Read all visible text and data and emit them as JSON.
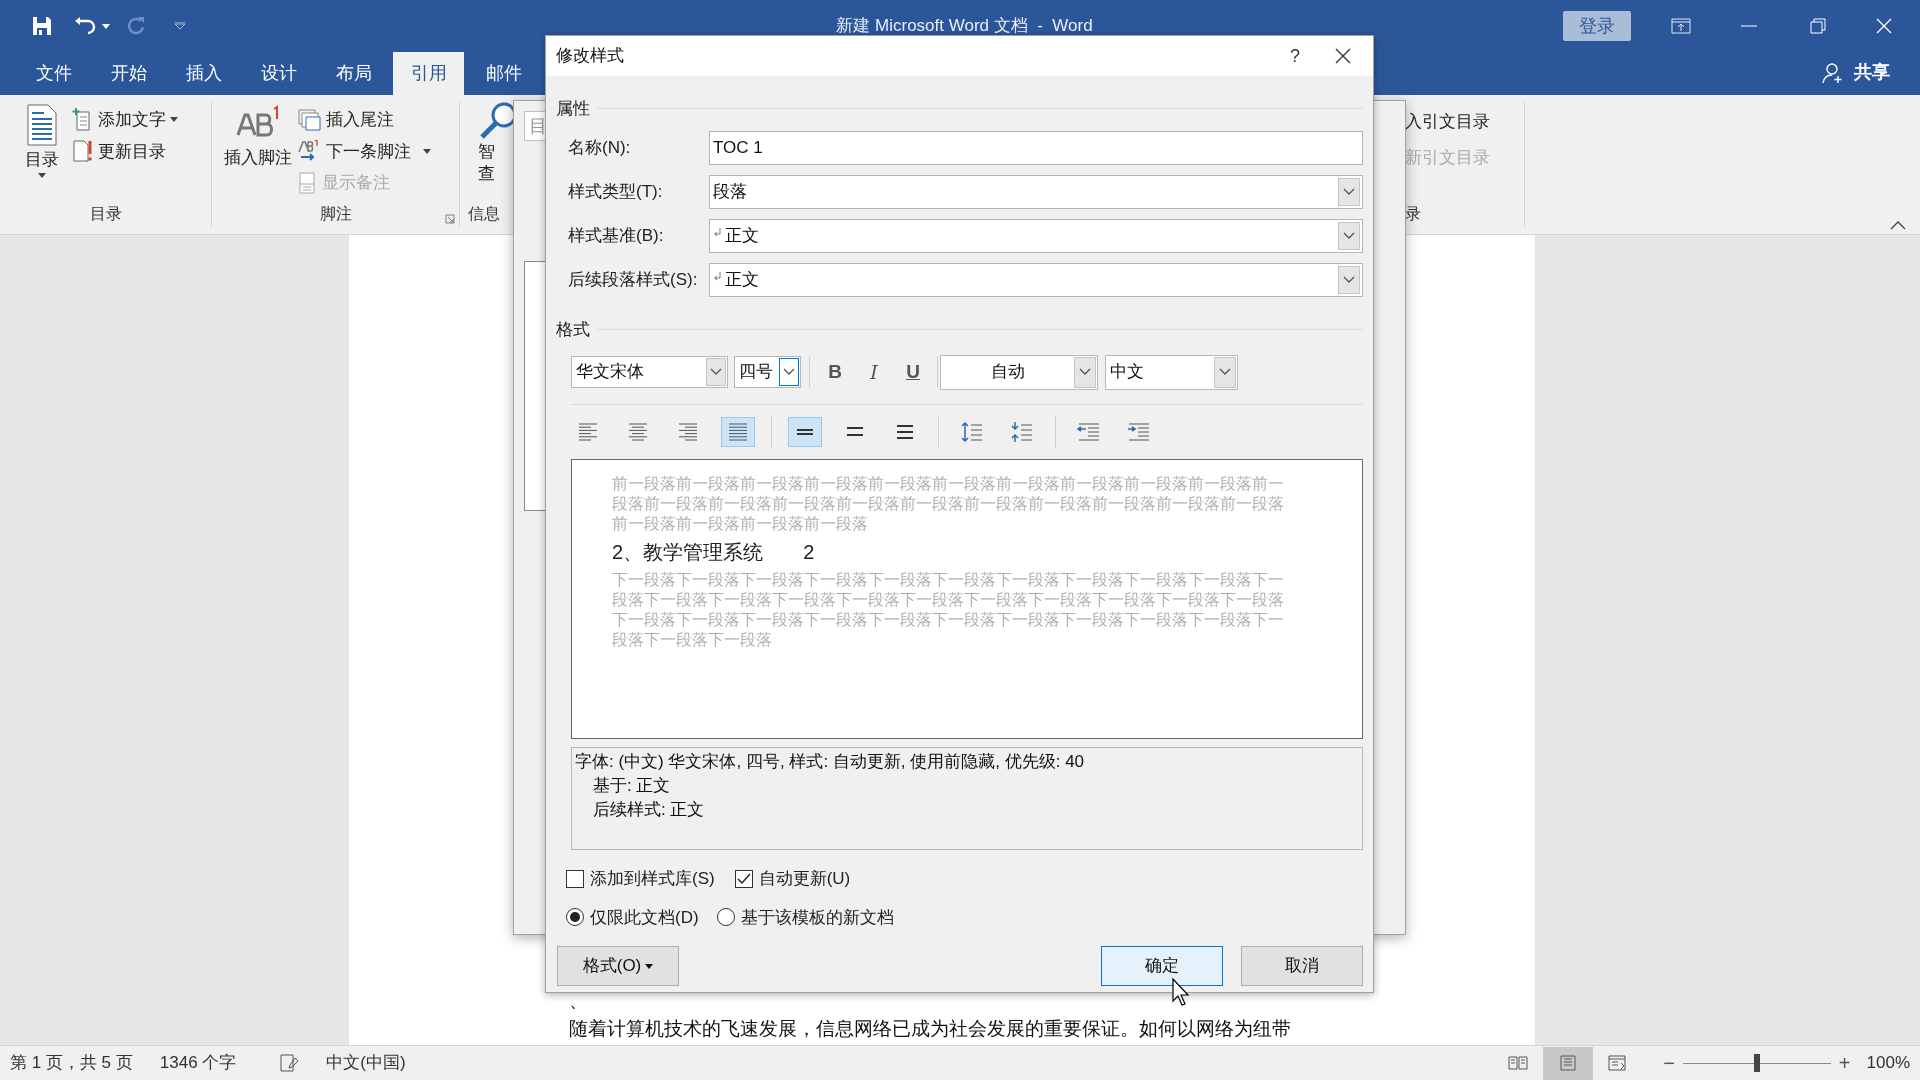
{
  "title_bar": {
    "title": "新建 Microsoft Word 文档  -  Word",
    "sign_in": "登录",
    "redo_disabled": true
  },
  "tabs": [
    {
      "label": "文件",
      "selected": false
    },
    {
      "label": "开始",
      "selected": false
    },
    {
      "label": "插入",
      "selected": false
    },
    {
      "label": "设计",
      "selected": false
    },
    {
      "label": "布局",
      "selected": false
    },
    {
      "label": "引用",
      "selected": true
    },
    {
      "label": "邮件",
      "selected": false
    }
  ],
  "share": "共享",
  "ribbon": {
    "toc_group": {
      "label": "目录",
      "toc_button": "目录",
      "add_text": "添加文字",
      "update_toc": "更新目录"
    },
    "footnotes_group": {
      "label": "脚注",
      "insert_footnote": "插入脚注",
      "insert_endnote": "插入尾注",
      "next_footnote": "下一条脚注",
      "show_notes": {
        "label": "显示备注",
        "disabled": true
      }
    },
    "research_group": {
      "label": "信息",
      "button_lines": [
        "智",
        "查"
      ]
    },
    "authorities_group": {
      "label": "录",
      "insert_table": "入引文目录",
      "update_table": {
        "label": "新引文目录",
        "disabled": true
      }
    }
  },
  "background_dialog": {
    "field_text": "目"
  },
  "dialog": {
    "title": "修改样式",
    "help": "?",
    "properties": {
      "heading": "属性",
      "fields": [
        {
          "label": "名称(N):",
          "value": "TOC 1",
          "kind": "text",
          "para_mark": false
        },
        {
          "label": "样式类型(T):",
          "value": "段落",
          "kind": "dropdown",
          "para_mark": false
        },
        {
          "label": "样式基准(B):",
          "value": "正文",
          "kind": "dropdown",
          "para_mark": true
        },
        {
          "label": "后续段落样式(S):",
          "value": "正文",
          "kind": "dropdown",
          "para_mark": true
        }
      ]
    },
    "format": {
      "heading": "格式",
      "font": "华文宋体",
      "size": "四号",
      "size_focused": true,
      "style_buttons": [
        {
          "label": "B",
          "kind": "bold",
          "selected": false
        },
        {
          "label": "I",
          "kind": "italic",
          "selected": false
        },
        {
          "label": "U",
          "kind": "underline",
          "selected": false
        }
      ],
      "color_text": "自动",
      "script": "中文",
      "align_buttons": [
        {
          "kind": "left",
          "selected": false
        },
        {
          "kind": "center",
          "selected": false
        },
        {
          "kind": "right",
          "selected": false
        },
        {
          "kind": "justify",
          "selected": true
        }
      ],
      "spacing_buttons": [
        {
          "kind": "single",
          "selected": true
        },
        {
          "kind": "onehalf",
          "selected": false
        },
        {
          "kind": "double",
          "selected": false
        }
      ],
      "paragraph_spacing_buttons": [
        {
          "kind": "increase"
        },
        {
          "kind": "decrease"
        }
      ],
      "indent_buttons": [
        {
          "kind": "decrease"
        },
        {
          "kind": "increase"
        }
      ]
    },
    "preview": {
      "before": "前一段落前一段落前一段落前一段落前一段落前一段落前一段落前一段落前一段落前一段落前一段落前一段落前一段落前一段落前一段落前一段落前一段落前一段落前一段落前一段落前一段落前一段落前一段落前一段落前一段落",
      "sample": "2、教学管理系统",
      "sample_page": "2",
      "after": "下一段落下一段落下一段落下一段落下一段落下一段落下一段落下一段落下一段落下一段落下一段落下一段落下一段落下一段落下一段落下一段落下一段落下一段落下一段落下一段落下一段落下一段落下一段落下一段落下一段落下一段落下一段落下一段落下一段落下一段落下一段落下一段落下一段落下一段落"
    },
    "description": [
      "字体: (中文) 华文宋体, 四号, 样式: 自动更新, 使用前隐藏, 优先级: 40",
      "基于: 正文",
      "后续样式: 正文"
    ],
    "checkboxes": [
      {
        "label": "添加到样式库(S)",
        "checked": false
      },
      {
        "label": "自动更新(U)",
        "checked": true
      }
    ],
    "radios": [
      {
        "label": "仅限此文档(D)",
        "selected": true
      },
      {
        "label": "基于该模板的新文档",
        "selected": false
      }
    ],
    "format_button": "格式(O)",
    "buttons": [
      {
        "label": "确定",
        "default": true
      },
      {
        "label": "取消",
        "default": false
      }
    ]
  },
  "document": {
    "lines": [
      "、",
      "随着计算机技术的飞速发展，信息网络已成为社会发展的重要保证。如何以网络为纽带"
    ]
  },
  "status_bar": {
    "page": "第 1 页，共 5 页",
    "words": "1346 个字",
    "language": "中文(中国)",
    "views": [
      {
        "kind": "read",
        "selected": false
      },
      {
        "kind": "print",
        "selected": true
      },
      {
        "kind": "web",
        "selected": false
      }
    ],
    "zoom_slider": {
      "level": 0.5
    },
    "zoom": "100%",
    "minus": "−",
    "plus": "+"
  }
}
